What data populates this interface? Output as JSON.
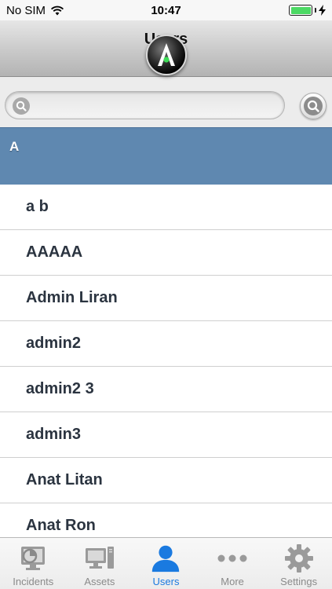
{
  "status_bar": {
    "carrier": "No SIM",
    "time": "10:47",
    "wifi_icon": "wifi-icon",
    "battery_icon": "battery-icon",
    "charging_icon": "charging-bolt-icon"
  },
  "nav": {
    "title": "Users",
    "logo_letter": "A"
  },
  "search": {
    "value": "",
    "placeholder": ""
  },
  "section": {
    "letter": "A"
  },
  "users": [
    "a b",
    "AAAAA",
    "Admin Liran",
    "admin2",
    "admin2 3",
    "admin3",
    "Anat Litan",
    "Anat Ron"
  ],
  "tabs": [
    {
      "label": "Incidents",
      "icon": "incidents-icon",
      "active": false
    },
    {
      "label": "Assets",
      "icon": "assets-icon",
      "active": false
    },
    {
      "label": "Users",
      "icon": "user-icon",
      "active": true
    },
    {
      "label": "More",
      "icon": "more-icon",
      "active": false
    },
    {
      "label": "Settings",
      "icon": "gear-icon",
      "active": false
    }
  ],
  "colors": {
    "section_header": "#5f88b0",
    "active_tab": "#1a7ae0",
    "inactive_tab": "#8a8a8a",
    "battery": "#4cd964",
    "logo_dot": "#3ddc57"
  }
}
